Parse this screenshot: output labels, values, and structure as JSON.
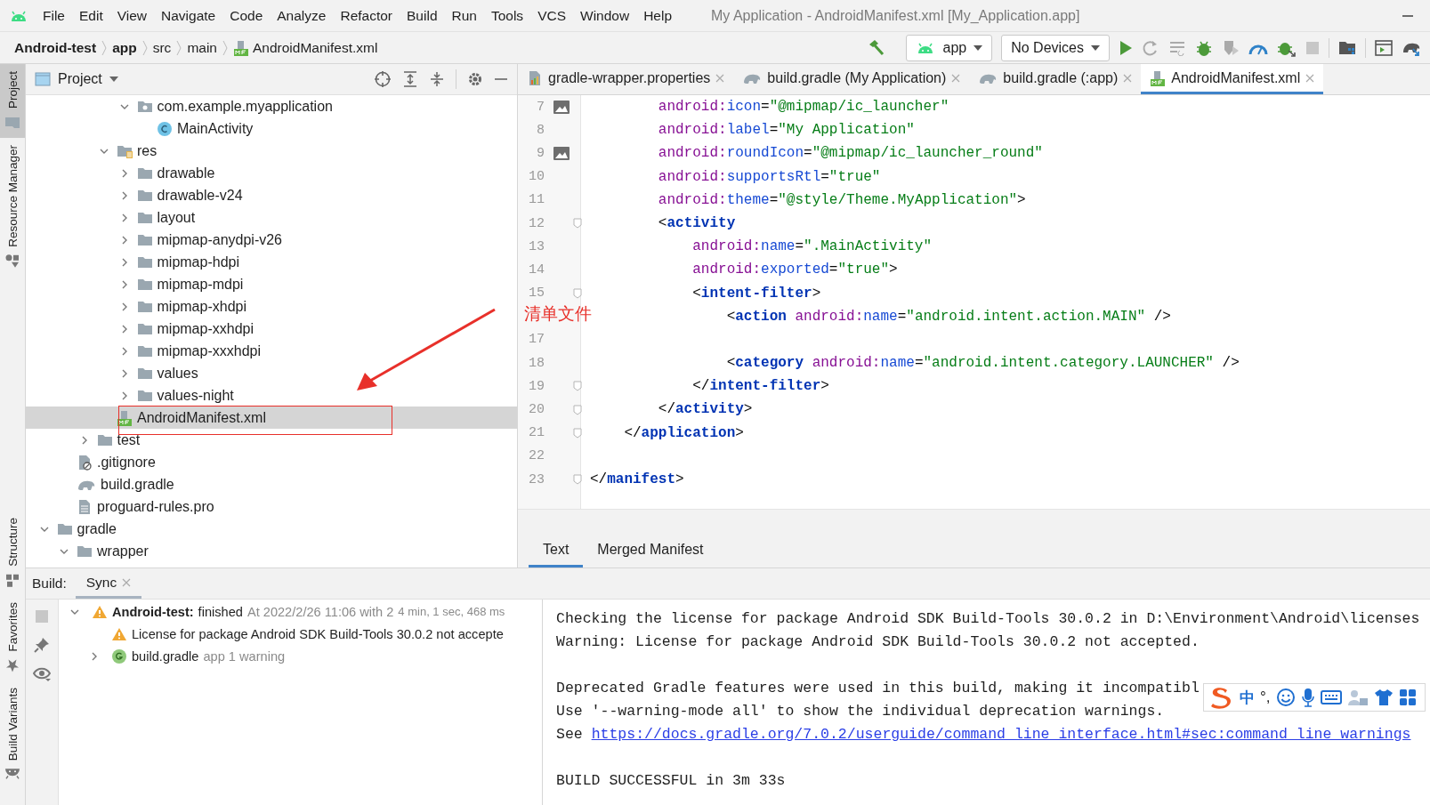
{
  "window": {
    "title": "My Application - AndroidManifest.xml [My_Application.app]"
  },
  "menu": [
    "File",
    "Edit",
    "View",
    "Navigate",
    "Code",
    "Analyze",
    "Refactor",
    "Build",
    "Run",
    "Tools",
    "VCS",
    "Window",
    "Help"
  ],
  "breadcrumbs": [
    {
      "label": "Android-test",
      "bold": true
    },
    {
      "label": "app",
      "bold": true
    },
    {
      "label": "src",
      "bold": false
    },
    {
      "label": "main",
      "bold": false
    },
    {
      "label": "AndroidManifest.xml",
      "bold": false,
      "kind": "manifest"
    }
  ],
  "run_toolbar": {
    "configuration": "app",
    "device": "No Devices"
  },
  "left_strip": {
    "top": [
      {
        "label": "Project",
        "kind": "folder",
        "selected": true
      },
      {
        "label": "Resource Manager",
        "kind": "shapes",
        "selected": false
      }
    ],
    "bottom": [
      {
        "label": "Structure",
        "kind": "structure",
        "selected": false
      },
      {
        "label": "Favorites",
        "kind": "star",
        "selected": false
      },
      {
        "label": "Build Variants",
        "kind": "android",
        "selected": false
      }
    ]
  },
  "project_panel": {
    "title": "Project",
    "tree": [
      {
        "children": [
          {
            "children": [
              {
                "children": [
                  {
                    "children": [
                      {
                        "label": "com.example.myapplication",
                        "kind": "package",
                        "expanded": true,
                        "selected": false,
                        "children": [
                          {
                            "label": "MainActivity",
                            "kind": "class",
                            "selected": false
                          }
                        ]
                      }
                    ]
                  },
                  {
                    "label": "res",
                    "kind": "res",
                    "expanded": true,
                    "selected": false,
                    "children": [
                      {
                        "label": "drawable",
                        "kind": "folder",
                        "expanded": false,
                        "selected": false
                      },
                      {
                        "label": "drawable-v24",
                        "kind": "folder",
                        "expanded": false,
                        "selected": false
                      },
                      {
                        "label": "layout",
                        "kind": "folder",
                        "expanded": false,
                        "selected": false
                      },
                      {
                        "label": "mipmap-anydpi-v26",
                        "kind": "folder",
                        "expanded": false,
                        "selected": false
                      },
                      {
                        "label": "mipmap-hdpi",
                        "kind": "folder",
                        "expanded": false,
                        "selected": false
                      },
                      {
                        "label": "mipmap-mdpi",
                        "kind": "folder",
                        "expanded": false,
                        "selected": false
                      },
                      {
                        "label": "mipmap-xhdpi",
                        "kind": "folder",
                        "expanded": false,
                        "selected": false
                      },
                      {
                        "label": "mipmap-xxhdpi",
                        "kind": "folder",
                        "expanded": false,
                        "selected": false
                      },
                      {
                        "label": "mipmap-xxxhdpi",
                        "kind": "folder",
                        "expanded": false,
                        "selected": false
                      },
                      {
                        "label": "values",
                        "kind": "folder",
                        "expanded": false,
                        "selected": false
                      },
                      {
                        "label": "values-night",
                        "kind": "folder",
                        "expanded": false,
                        "selected": false
                      }
                    ]
                  },
                  {
                    "label": "AndroidManifest.xml",
                    "kind": "manifest",
                    "selected": true
                  }
                ]
              },
              {
                "label": "test",
                "kind": "folder",
                "expanded": false,
                "selected": false
              }
            ]
          },
          {
            "label": ".gitignore",
            "kind": "ignore",
            "selected": false
          },
          {
            "label": "build.gradle",
            "kind": "gradle",
            "selected": false
          },
          {
            "label": "proguard-rules.pro",
            "kind": "text",
            "selected": false
          }
        ]
      },
      {
        "label": "gradle",
        "kind": "folder",
        "expanded": true,
        "selected": false,
        "children": [
          {
            "label": "wrapper",
            "kind": "folder",
            "expanded": true,
            "selected": false
          }
        ]
      }
    ]
  },
  "editor_tabs": [
    {
      "label": "gradle-wrapper.properties",
      "kind": "properties",
      "selected": false
    },
    {
      "label": "build.gradle (My Application)",
      "kind": "gradle",
      "selected": false
    },
    {
      "label": "build.gradle (:app)",
      "kind": "gradle",
      "selected": false
    },
    {
      "label": "AndroidManifest.xml",
      "kind": "manifest",
      "selected": true
    }
  ],
  "code_lines": [
    {
      "n": "7",
      "kind": "image",
      "tokens": [
        {
          "kind": "ns",
          "text": "        android:"
        },
        {
          "kind": "attr",
          "text": "icon"
        },
        {
          "kind": "p",
          "text": "="
        },
        {
          "kind": "str",
          "text": "\"@mipmap/ic_launcher\""
        }
      ]
    },
    {
      "n": "8",
      "tokens": [
        {
          "kind": "ns",
          "text": "        android:"
        },
        {
          "kind": "attr",
          "text": "label"
        },
        {
          "kind": "p",
          "text": "="
        },
        {
          "kind": "str",
          "text": "\"My Application\""
        }
      ]
    },
    {
      "n": "9",
      "kind": "image",
      "tokens": [
        {
          "kind": "ns",
          "text": "        android:"
        },
        {
          "kind": "attr",
          "text": "roundIcon"
        },
        {
          "kind": "p",
          "text": "="
        },
        {
          "kind": "str",
          "text": "\"@mipmap/ic_launcher_round\""
        }
      ]
    },
    {
      "n": "10",
      "tokens": [
        {
          "kind": "ns",
          "text": "        android:"
        },
        {
          "kind": "attr",
          "text": "supportsRtl"
        },
        {
          "kind": "p",
          "text": "="
        },
        {
          "kind": "str",
          "text": "\"true\""
        }
      ]
    },
    {
      "n": "11",
      "tokens": [
        {
          "kind": "ns",
          "text": "        android:"
        },
        {
          "kind": "attr",
          "text": "theme"
        },
        {
          "kind": "p",
          "text": "="
        },
        {
          "kind": "str",
          "text": "\"@style/Theme.MyApplication\""
        },
        {
          "kind": "p",
          "text": ">"
        }
      ]
    },
    {
      "n": "12",
      "kind": "fold",
      "tokens": [
        {
          "kind": "p",
          "text": "        <"
        },
        {
          "kind": "tag",
          "text": "activity"
        }
      ]
    },
    {
      "n": "13",
      "tokens": [
        {
          "kind": "ns",
          "text": "            android:"
        },
        {
          "kind": "attr",
          "text": "name"
        },
        {
          "kind": "p",
          "text": "="
        },
        {
          "kind": "str",
          "text": "\".MainActivity\""
        }
      ]
    },
    {
      "n": "14",
      "tokens": [
        {
          "kind": "ns",
          "text": "            android:"
        },
        {
          "kind": "attr",
          "text": "exported"
        },
        {
          "kind": "p",
          "text": "="
        },
        {
          "kind": "str",
          "text": "\"true\""
        },
        {
          "kind": "p",
          "text": ">"
        }
      ]
    },
    {
      "n": "15",
      "kind": "fold",
      "tokens": [
        {
          "kind": "p",
          "text": "            <"
        },
        {
          "kind": "tag",
          "text": "intent-filter"
        },
        {
          "kind": "p",
          "text": ">"
        }
      ]
    },
    {
      "tokens": [
        {
          "kind": "p",
          "text": "                <"
        },
        {
          "kind": "tag",
          "text": "action"
        },
        {
          "kind": "ns",
          "text": " android:"
        },
        {
          "kind": "attr",
          "text": "name"
        },
        {
          "kind": "p",
          "text": "="
        },
        {
          "kind": "str",
          "text": "\"android.intent.action.MAIN\""
        },
        {
          "kind": "p",
          "text": " />"
        }
      ]
    },
    {
      "n": "17"
    },
    {
      "n": "18",
      "tokens": [
        {
          "kind": "p",
          "text": "                <"
        },
        {
          "kind": "tag",
          "text": "category"
        },
        {
          "kind": "ns",
          "text": " android:"
        },
        {
          "kind": "attr",
          "text": "name"
        },
        {
          "kind": "p",
          "text": "="
        },
        {
          "kind": "str",
          "text": "\"android.intent.category.LAUNCHER\""
        },
        {
          "kind": "p",
          "text": " />"
        }
      ]
    },
    {
      "n": "19",
      "kind": "fold",
      "tokens": [
        {
          "kind": "p",
          "text": "            </"
        },
        {
          "kind": "tag",
          "text": "intent-filter"
        },
        {
          "kind": "p",
          "text": ">"
        }
      ]
    },
    {
      "n": "20",
      "kind": "fold",
      "tokens": [
        {
          "kind": "p",
          "text": "        </"
        },
        {
          "kind": "tag",
          "text": "activity"
        },
        {
          "kind": "p",
          "text": ">"
        }
      ]
    },
    {
      "n": "21",
      "kind": "fold",
      "tokens": [
        {
          "kind": "p",
          "text": "    </"
        },
        {
          "kind": "tag",
          "text": "application"
        },
        {
          "kind": "p",
          "text": ">"
        }
      ]
    },
    {
      "n": "22"
    },
    {
      "n": "23",
      "kind": "fold",
      "tokens": [
        {
          "kind": "p",
          "text": "</"
        },
        {
          "kind": "tag",
          "text": "manifest"
        },
        {
          "kind": "p",
          "text": ">"
        }
      ]
    }
  ],
  "editor_bottom_tabs": [
    {
      "label": "Text",
      "selected": true
    },
    {
      "label": "Merged Manifest",
      "selected": false
    }
  ],
  "annotation": {
    "label": "清单文件"
  },
  "build_panel": {
    "label": "Build:",
    "tabs": [
      {
        "label": "Sync",
        "selected": true
      }
    ],
    "tree": [
      {
        "kind": "summary",
        "expanded": true,
        "title": "Android-test:",
        "status": "finished",
        "detail": "At 2022/2/26 11:06 with 2",
        "duration": "4 min, 1 sec, 468 ms",
        "children": [
          {
            "kind": "warning",
            "text": "License for package Android SDK Build-Tools 30.0.2 not accepte"
          },
          {
            "kind": "gradle",
            "expanded": false,
            "title": "build.gradle",
            "detail": "app 1 warning"
          }
        ]
      }
    ],
    "console": [
      [
        {
          "kind": "text",
          "text": "Checking the license for package Android SDK Build-Tools 30.0.2 in D:\\Environment\\Android\\licenses"
        },
        {
          "kind": "text",
          "text": "Warning: License for package Android SDK Build-Tools 30.0.2 not accepted."
        }
      ],
      [
        {
          "kind": "text",
          "text": "Deprecated Gradle features were used in this build, making it incompatibl"
        },
        {
          "kind": "text",
          "text": "Use '--warning-mode all' to show the individual deprecation warnings."
        },
        {
          "kind": "link",
          "prefix": "See",
          "link": "https://docs.gradle.org/7.0.2/userguide/command_line_interface.html#sec:command_line_warnings"
        }
      ],
      [
        {
          "kind": "text",
          "text": "BUILD SUCCESSFUL in 3m 33s"
        }
      ]
    ]
  },
  "ime_toolbar": {
    "mode": "中",
    "punctuation": "°,"
  }
}
